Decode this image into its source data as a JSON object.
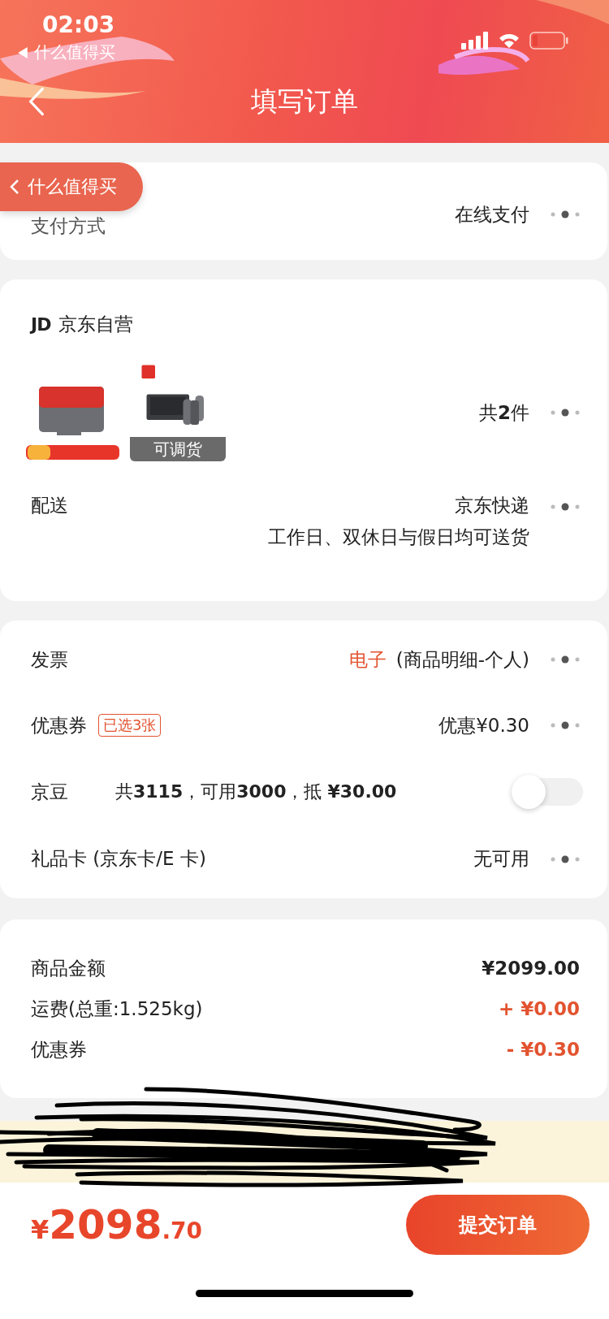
{
  "status_bar": {
    "time": "02:03",
    "back_app": "什么值得买"
  },
  "nav": {
    "title": "填写订单"
  },
  "float_back": {
    "label": "什么值得买"
  },
  "payment": {
    "label": "支付方式",
    "value": "在线支付"
  },
  "shop": {
    "logo": "JD",
    "name": "京东自营",
    "products": [
      {
        "kind": "picture"
      },
      {
        "kind": "picture",
        "overlay": "可调货"
      }
    ],
    "count": "共**2**件",
    "delivery": {
      "label": "配送",
      "value": "京东快递",
      "note": "工作日、双休日与假日均可送货"
    }
  },
  "options": [
    {
      "kind": "link",
      "label": "发票",
      "highlight": "电子",
      "value": "(商品明细-个人)"
    },
    {
      "kind": "link",
      "label": "优惠券",
      "tag": "已选3张",
      "value": "优惠¥0.30"
    },
    {
      "kind": "toggle",
      "label": "京豆",
      "detail": "共**3115**，可用**3000**，抵 **¥30.00**",
      "on": false
    },
    {
      "kind": "link",
      "label": "礼品卡 (京东卡/E 卡)",
      "value": "无可用"
    }
  ],
  "summary": [
    {
      "label": "商品金额",
      "value": "¥2099.00",
      "highlighted": false
    },
    {
      "label": "运费(总重:1.525kg)",
      "value": "+ ¥0.00",
      "highlighted": true
    },
    {
      "label": "优惠券",
      "value": "- ¥0.30",
      "highlighted": true
    }
  ],
  "footer": {
    "currency": "¥",
    "integer": "2098",
    "decimal": ".70",
    "submit": "提交订单"
  }
}
